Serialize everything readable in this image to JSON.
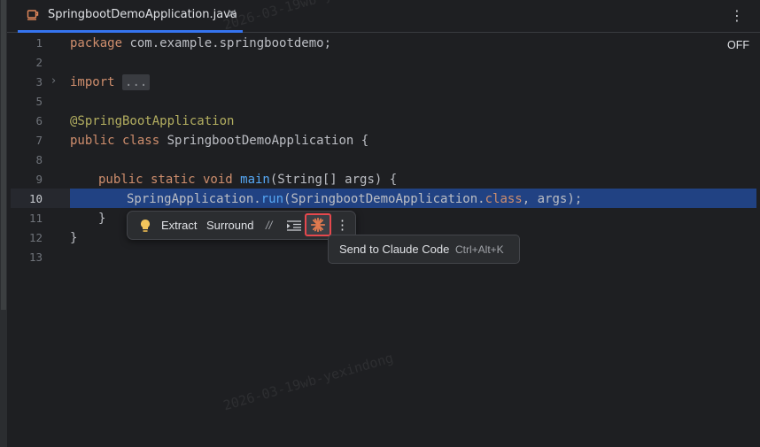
{
  "tab": {
    "title": "SpringbootDemoApplication.java",
    "close": "✕"
  },
  "menu_icon": "⋮",
  "reader_mode": "OFF",
  "gutter": [
    "1",
    "2",
    "3",
    "5",
    "6",
    "7",
    "8",
    "9",
    "10",
    "11",
    "12",
    "13"
  ],
  "code": {
    "l1_kw": "package",
    "l1_rest": " com.example.springbootdemo;",
    "l3_kw": "import",
    "l3_folded": "...",
    "l6": "@SpringBootApplication",
    "l7_kw": "public class",
    "l7_rest": " SpringbootDemoApplication {",
    "l9_kw": "public static void",
    "l9_fn": " main",
    "l9_rest": "(String[] args) {",
    "l10_pre": "SpringApplication.",
    "l10_fn": "run",
    "l10_mid": "(SpringbootDemoApplication.",
    "l10_kw": "class",
    "l10_post": ", args);",
    "l11": "}",
    "l12": "}"
  },
  "floating_toolbar": {
    "extract": "Extract",
    "surround": "Surround",
    "comment": "//",
    "more": "⋮"
  },
  "tooltip": {
    "label": "Send to Claude Code",
    "shortcut": "Ctrl+Alt+K"
  },
  "watermark": "2026-03-19wb-yexindong",
  "colors": {
    "selection": "#214283",
    "keyword": "#cf8e6d",
    "function": "#56a8f5",
    "annotation": "#b3ae60",
    "accent": "#3574f0",
    "highlight": "#e5484d"
  }
}
